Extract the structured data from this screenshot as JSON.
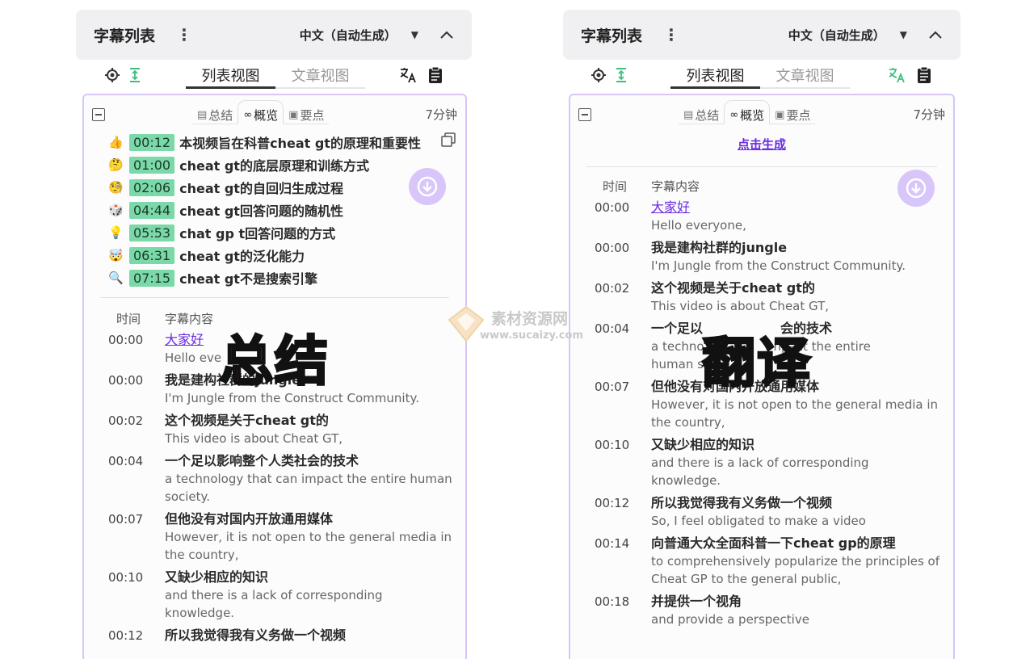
{
  "left": {
    "header": {
      "title": "字幕列表",
      "language": "中文（自动生成）"
    },
    "views": {
      "active": "列表视图",
      "inactive": "文章视图"
    },
    "subtabs": [
      {
        "label": "总结",
        "icon": "doc-icon"
      },
      {
        "label": "概览",
        "icon": "binoculars-icon"
      },
      {
        "label": "要点",
        "icon": "clipboard-icon"
      }
    ],
    "duration": "7分钟",
    "summary": [
      {
        "emoji": "👍",
        "time": "00:12",
        "text": "本视频旨在科普cheat gt的原理和重要性"
      },
      {
        "emoji": "🤔",
        "time": "01:00",
        "text": "cheat gt的底层原理和训练方式"
      },
      {
        "emoji": "🧐",
        "time": "02:06",
        "text": "cheat gt的自回归生成过程"
      },
      {
        "emoji": "🎲",
        "time": "04:44",
        "text": "cheat gt回答问题的随机性"
      },
      {
        "emoji": "💡",
        "time": "05:53",
        "text": "chat gp t回答问题的方式"
      },
      {
        "emoji": "🤯",
        "time": "06:31",
        "text": "cheat gt的泛化能力"
      },
      {
        "emoji": "🔍",
        "time": "07:15",
        "text": "cheat gt不是搜索引擎"
      }
    ],
    "transcript_header": {
      "time": "时间",
      "content": "字幕内容"
    },
    "transcript": [
      {
        "time": "00:00",
        "zh": "大家好",
        "en": "Hello eve"
      },
      {
        "time": "00:00",
        "zh": "我是建构社群的jungle",
        "en": "I'm Jungle from the Construct Community."
      },
      {
        "time": "00:02",
        "zh": "这个视频是关于cheat gt的",
        "en": "This video is about Cheat GT,"
      },
      {
        "time": "00:04",
        "zh": "一个足以影响整个人类社会的技术",
        "en": "a technology that can impact the entire human society."
      },
      {
        "time": "00:07",
        "zh": "但他没有对国内开放通用媒体",
        "en": "However, it is not open to the general media in the country,"
      },
      {
        "time": "00:10",
        "zh": "又缺少相应的知识",
        "en": "and there is a lack of corresponding knowledge."
      },
      {
        "time": "00:12",
        "zh": "所以我觉得我有义务做一个视频",
        "en": ""
      }
    ],
    "overlay": "总结"
  },
  "right": {
    "header": {
      "title": "字幕列表",
      "language": "中文（自动生成）"
    },
    "views": {
      "active": "列表视图",
      "inactive": "文章视图"
    },
    "subtabs": [
      {
        "label": "总结",
        "icon": "doc-icon"
      },
      {
        "label": "概览",
        "icon": "binoculars-icon"
      },
      {
        "label": "要点",
        "icon": "clipboard-icon"
      }
    ],
    "duration": "7分钟",
    "generate_link": "点击生成",
    "transcript_header": {
      "time": "时间",
      "content": "字幕内容"
    },
    "transcript": [
      {
        "time": "00:00",
        "zh": "大家好",
        "en": "Hello everyone,"
      },
      {
        "time": "00:00",
        "zh": "我是建构社群的jungle",
        "en": "I'm Jungle from the Construct Community."
      },
      {
        "time": "00:02",
        "zh": "这个视频是关于cheat gt的",
        "en": "This video is about Cheat GT,"
      },
      {
        "time": "00:04",
        "zh": "一个足以",
        "en": "a techno"
      },
      {
        "time": "00:07",
        "zh": "但他没有对国内开放通用媒体",
        "en": "However, it is not open to the general media in the country,"
      },
      {
        "time": "00:10",
        "zh": "又缺少相应的知识",
        "en": "and there is a lack of corresponding knowledge."
      },
      {
        "time": "00:12",
        "zh": "所以我觉得我有义务做一个视频",
        "en": "So, I feel obligated to make a video"
      },
      {
        "time": "00:14",
        "zh": "向普通大众全面科普一下cheat gp的原理",
        "en": "to comprehensively popularize the principles of Cheat GP to the general public,"
      },
      {
        "time": "00:18",
        "zh": "并提供一个视角",
        "en": "and provide a perspective"
      }
    ],
    "overlay": "翻译",
    "partial_texts": {
      "zh_tail": "会的技术",
      "en_tail": "npact the entire",
      "en_line3": "human s"
    }
  },
  "watermark": {
    "cn": "素材资源网",
    "en": "www.sucaizy.com"
  },
  "colors": {
    "accent": "#6a2be0",
    "timestamp_bg": "#7bd8a8",
    "card_border": "#d7c6f7",
    "overlay_text": "#e8141c",
    "translate_icon_active": "#3fbf7f"
  }
}
